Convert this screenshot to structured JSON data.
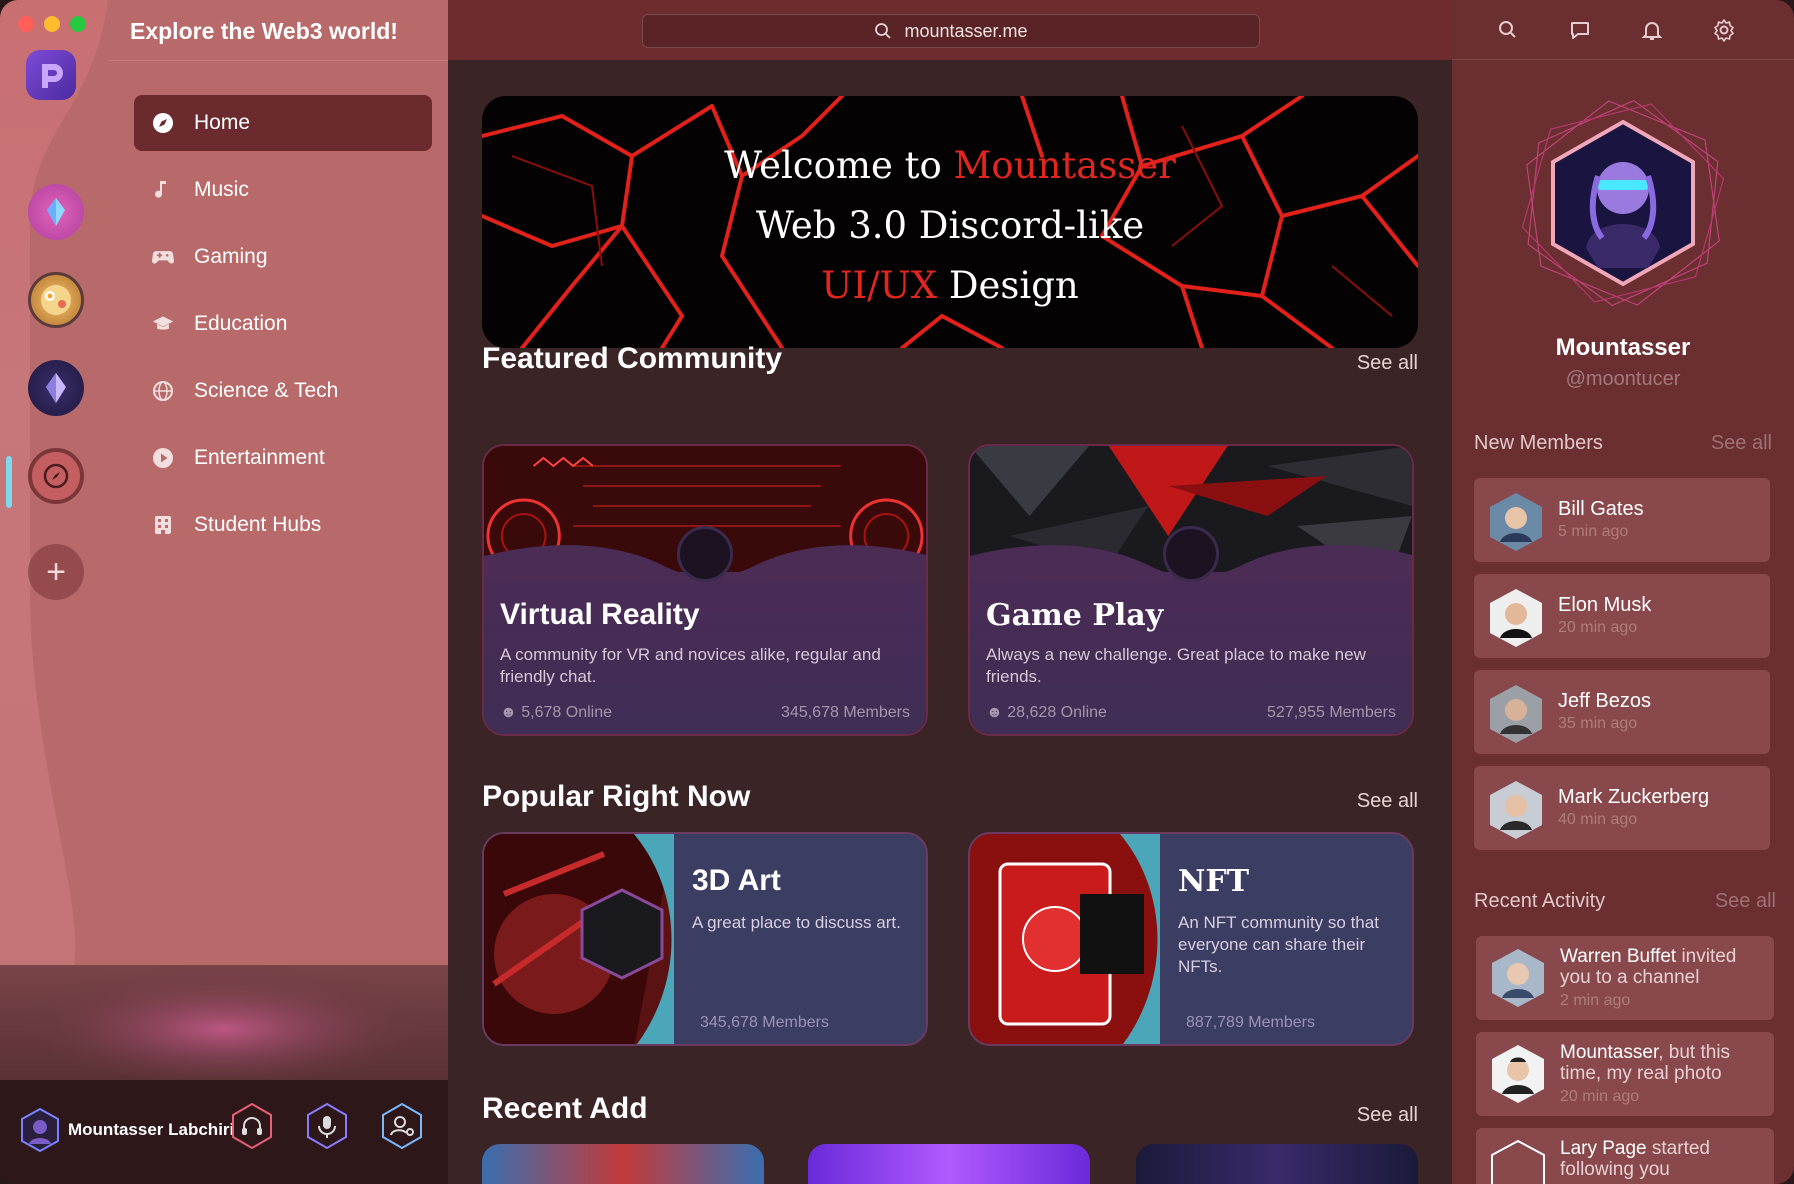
{
  "app": {
    "title": "Explore the Web3 world!",
    "url": "mountasser.me"
  },
  "nav": {
    "items": [
      {
        "label": "Home",
        "icon": "compass-icon",
        "active": true
      },
      {
        "label": "Music",
        "icon": "music-note-icon",
        "active": false
      },
      {
        "label": "Gaming",
        "icon": "gamepad-icon",
        "active": false
      },
      {
        "label": "Education",
        "icon": "graduation-cap-icon",
        "active": false
      },
      {
        "label": "Science & Tech",
        "icon": "globe-icon",
        "active": false
      },
      {
        "label": "Entertainment",
        "icon": "play-circle-icon",
        "active": false
      },
      {
        "label": "Student Hubs",
        "icon": "building-icon",
        "active": false
      }
    ]
  },
  "user": {
    "name": "Mountasser Labchiri"
  },
  "hero": {
    "line1a": "Welcome to ",
    "line1b": "Mountasser",
    "line2": "Web 3.0 Discord-like",
    "line3a": "UI/UX",
    "line3b": " Design"
  },
  "featured": {
    "title": "Featured Community",
    "see_all": "See all",
    "cards": [
      {
        "title": "Virtual Reality",
        "desc": "A community for VR and novices alike, regular and friendly chat.",
        "online": "5,678 Online",
        "members": "345,678 Members"
      },
      {
        "title": "Game Play",
        "desc": "Always a new challenge. Great place to make new friends.",
        "online": "28,628 Online",
        "members": "527,955 Members"
      }
    ]
  },
  "popular": {
    "title": "Popular Right Now",
    "see_all": "See all",
    "cards": [
      {
        "title": "3D Art",
        "desc": "A great place to discuss art.",
        "members": "345,678 Members"
      },
      {
        "title": "NFT",
        "desc": "An NFT community so that everyone can share their NFTs.",
        "members": "887,789 Members"
      }
    ]
  },
  "recent_add": {
    "title": "Recent Add",
    "see_all": "See all"
  },
  "profile": {
    "name": "Mountasser",
    "handle": "@moontucer"
  },
  "new_members": {
    "title": "New Members",
    "see_all": "See all",
    "items": [
      {
        "name": "Bill Gates",
        "time": "5 min ago"
      },
      {
        "name": "Elon Musk",
        "time": "20 min ago"
      },
      {
        "name": "Jeff Bezos",
        "time": "35 min ago"
      },
      {
        "name": "Mark Zuckerberg",
        "time": "40 min ago"
      }
    ]
  },
  "recent_activity": {
    "title": "Recent Activity",
    "see_all": "See all",
    "items": [
      {
        "actor": "Warren Buffet",
        "text": " invited you to a channel",
        "time": "2 min ago"
      },
      {
        "actor": "Mountasser",
        "text": ", but this time, my real photo",
        "time": "20 min ago"
      },
      {
        "actor": "Lary Page",
        "text": " started following you",
        "time": ""
      }
    ]
  },
  "colors": {
    "accent_red": "#e0261f",
    "nav_active": "#6b2b2e",
    "panel": "#6b2e31"
  }
}
